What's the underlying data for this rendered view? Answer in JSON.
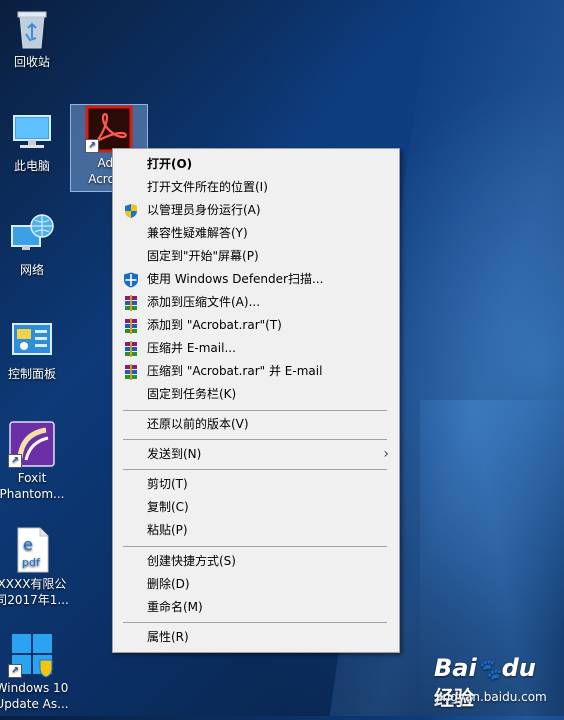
{
  "desktop": {
    "icons": [
      {
        "label": "回收站"
      },
      {
        "label": "此电脑"
      },
      {
        "label": "网络"
      },
      {
        "label": "控制面板"
      },
      {
        "label_line1": "Foxit",
        "label_line2": "Phantom..."
      },
      {
        "label_line1": "XXXX有限公",
        "label_line2": "司2017年1..."
      },
      {
        "label_line1": "Windows 10",
        "label_line2": "Update As..."
      }
    ],
    "selected_icon": {
      "label_line1": "Ado",
      "label_line2": "Acroba"
    }
  },
  "context_menu": {
    "items": [
      {
        "label": "打开(O)",
        "bold": true,
        "icon": ""
      },
      {
        "label": "打开文件所在的位置(I)",
        "icon": ""
      },
      {
        "label": "以管理员身份运行(A)",
        "icon": "uac-shield-icon"
      },
      {
        "label": "兼容性疑难解答(Y)",
        "icon": ""
      },
      {
        "label": "固定到\"开始\"屏幕(P)",
        "icon": ""
      },
      {
        "label": "使用 Windows Defender扫描...",
        "icon": "windows-defender-icon"
      },
      {
        "label": "添加到压缩文件(A)...",
        "icon": "winrar-icon"
      },
      {
        "label": "添加到 \"Acrobat.rar\"(T)",
        "icon": "winrar-icon"
      },
      {
        "label": "压缩并 E-mail...",
        "icon": "winrar-icon"
      },
      {
        "label": "压缩到 \"Acrobat.rar\" 并 E-mail",
        "icon": "winrar-icon"
      },
      {
        "label": "固定到任务栏(K)",
        "icon": ""
      },
      {
        "label": "还原以前的版本(V)",
        "icon": ""
      },
      {
        "label": "发送到(N)",
        "icon": "",
        "submenu": true
      },
      {
        "label": "剪切(T)",
        "icon": ""
      },
      {
        "label": "复制(C)",
        "icon": ""
      },
      {
        "label": "粘贴(P)",
        "icon": ""
      },
      {
        "label": "创建快捷方式(S)",
        "icon": ""
      },
      {
        "label": "删除(D)",
        "icon": ""
      },
      {
        "label": "重命名(M)",
        "icon": ""
      },
      {
        "label": "属性(R)",
        "icon": ""
      }
    ],
    "submenu_arrow": "›"
  },
  "watermark": {
    "brand": "Bai",
    "brand2": "du",
    "product": "经验",
    "url": "jingyan.baidu.com"
  },
  "colors": {
    "menu_bg": "#f0f0f0",
    "separator": "#a0a0a0",
    "acrobat_red": "#b5170f",
    "shield_blue": "#1f6fd1",
    "shield_yellow": "#f2c511"
  }
}
